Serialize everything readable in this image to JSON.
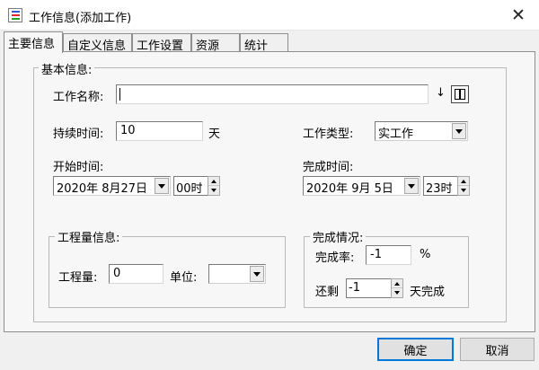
{
  "window": {
    "title": "工作信息(添加工作)",
    "close_glyph": "✕"
  },
  "tabs": [
    {
      "label": "主要信息",
      "active": true
    },
    {
      "label": "自定义信息"
    },
    {
      "label": "工作设置"
    },
    {
      "label": "资源"
    },
    {
      "label": "统计"
    }
  ],
  "basic": {
    "legend": "基本信息:",
    "name_label": "工作名称:",
    "name_value": "",
    "duration_label": "持续时间:",
    "duration_value": "10",
    "duration_unit": "天",
    "type_label": "工作类型:",
    "type_value": "实工作",
    "start_label": "开始时间:",
    "start_date": "2020年 8月27日",
    "start_hour": "00时",
    "finish_label": "完成时间:",
    "finish_date": "2020年 9月 5日",
    "finish_hour": "23时"
  },
  "quantity": {
    "legend": "工程量信息:",
    "amount_label": "工程量:",
    "amount_value": "0",
    "unit_label": "单位:",
    "unit_value": ""
  },
  "completion": {
    "legend": "完成情况:",
    "rate_label": "完成率:",
    "rate_value": "-1",
    "rate_unit": "%",
    "remain_label": "还剩",
    "remain_value": "-1",
    "remain_unit": "天完成"
  },
  "buttons": {
    "ok": "确定",
    "cancel": "取消"
  },
  "icons": {
    "app": "app-list-icon",
    "sort": "sort-down-icon",
    "columns": "columns-icon"
  },
  "colors": {
    "accent": "#0078d7"
  }
}
